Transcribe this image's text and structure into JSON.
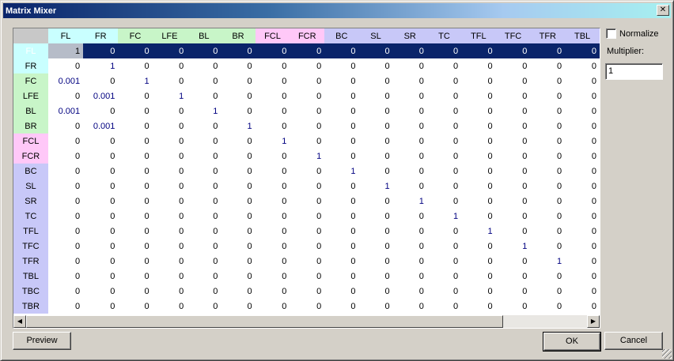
{
  "window": {
    "title": "Matrix Mixer",
    "close_glyph": "✕"
  },
  "columns": [
    {
      "label": "FL",
      "color": "#c9ffff"
    },
    {
      "label": "FR",
      "color": "#c9ffff"
    },
    {
      "label": "FC",
      "color": "#c8f5c8"
    },
    {
      "label": "LFE",
      "color": "#c8f5c8"
    },
    {
      "label": "BL",
      "color": "#c8f5c8"
    },
    {
      "label": "BR",
      "color": "#c8f5c8"
    },
    {
      "label": "FCL",
      "color": "#ffc8f8"
    },
    {
      "label": "FCR",
      "color": "#ffc8f8"
    },
    {
      "label": "BC",
      "color": "#c8c8f8"
    },
    {
      "label": "SL",
      "color": "#c8c8f8"
    },
    {
      "label": "SR",
      "color": "#c8c8f8"
    },
    {
      "label": "TC",
      "color": "#c8c8f8"
    },
    {
      "label": "TFL",
      "color": "#c8c8f8"
    },
    {
      "label": "TFC",
      "color": "#c8c8f8"
    },
    {
      "label": "TFR",
      "color": "#c8c8f8"
    },
    {
      "label": "TBL",
      "color": "#c8c8f8"
    }
  ],
  "rows": [
    {
      "label": "FL",
      "color": "#c9ffff",
      "values": [
        "1",
        "0",
        "0",
        "0",
        "0",
        "0",
        "0",
        "0",
        "0",
        "0",
        "0",
        "0",
        "0",
        "0",
        "0",
        "0"
      ]
    },
    {
      "label": "FR",
      "color": "#c9ffff",
      "values": [
        "0",
        "1",
        "0",
        "0",
        "0",
        "0",
        "0",
        "0",
        "0",
        "0",
        "0",
        "0",
        "0",
        "0",
        "0",
        "0"
      ]
    },
    {
      "label": "FC",
      "color": "#c8f5c8",
      "values": [
        "0.001",
        "0",
        "1",
        "0",
        "0",
        "0",
        "0",
        "0",
        "0",
        "0",
        "0",
        "0",
        "0",
        "0",
        "0",
        "0"
      ]
    },
    {
      "label": "LFE",
      "color": "#c8f5c8",
      "values": [
        "0",
        "0.001",
        "0",
        "1",
        "0",
        "0",
        "0",
        "0",
        "0",
        "0",
        "0",
        "0",
        "0",
        "0",
        "0",
        "0"
      ]
    },
    {
      "label": "BL",
      "color": "#c8f5c8",
      "values": [
        "0.001",
        "0",
        "0",
        "0",
        "1",
        "0",
        "0",
        "0",
        "0",
        "0",
        "0",
        "0",
        "0",
        "0",
        "0",
        "0"
      ]
    },
    {
      "label": "BR",
      "color": "#c8f5c8",
      "values": [
        "0",
        "0.001",
        "0",
        "0",
        "0",
        "1",
        "0",
        "0",
        "0",
        "0",
        "0",
        "0",
        "0",
        "0",
        "0",
        "0"
      ]
    },
    {
      "label": "FCL",
      "color": "#ffc8f8",
      "values": [
        "0",
        "0",
        "0",
        "0",
        "0",
        "0",
        "1",
        "0",
        "0",
        "0",
        "0",
        "0",
        "0",
        "0",
        "0",
        "0"
      ]
    },
    {
      "label": "FCR",
      "color": "#ffc8f8",
      "values": [
        "0",
        "0",
        "0",
        "0",
        "0",
        "0",
        "0",
        "1",
        "0",
        "0",
        "0",
        "0",
        "0",
        "0",
        "0",
        "0"
      ]
    },
    {
      "label": "BC",
      "color": "#c8c8f8",
      "values": [
        "0",
        "0",
        "0",
        "0",
        "0",
        "0",
        "0",
        "0",
        "1",
        "0",
        "0",
        "0",
        "0",
        "0",
        "0",
        "0"
      ]
    },
    {
      "label": "SL",
      "color": "#c8c8f8",
      "values": [
        "0",
        "0",
        "0",
        "0",
        "0",
        "0",
        "0",
        "0",
        "0",
        "1",
        "0",
        "0",
        "0",
        "0",
        "0",
        "0"
      ]
    },
    {
      "label": "SR",
      "color": "#c8c8f8",
      "values": [
        "0",
        "0",
        "0",
        "0",
        "0",
        "0",
        "0",
        "0",
        "0",
        "0",
        "1",
        "0",
        "0",
        "0",
        "0",
        "0"
      ]
    },
    {
      "label": "TC",
      "color": "#c8c8f8",
      "values": [
        "0",
        "0",
        "0",
        "0",
        "0",
        "0",
        "0",
        "0",
        "0",
        "0",
        "0",
        "1",
        "0",
        "0",
        "0",
        "0"
      ]
    },
    {
      "label": "TFL",
      "color": "#c8c8f8",
      "values": [
        "0",
        "0",
        "0",
        "0",
        "0",
        "0",
        "0",
        "0",
        "0",
        "0",
        "0",
        "0",
        "1",
        "0",
        "0",
        "0"
      ]
    },
    {
      "label": "TFC",
      "color": "#c8c8f8",
      "values": [
        "0",
        "0",
        "0",
        "0",
        "0",
        "0",
        "0",
        "0",
        "0",
        "0",
        "0",
        "0",
        "0",
        "1",
        "0",
        "0"
      ]
    },
    {
      "label": "TFR",
      "color": "#c8c8f8",
      "values": [
        "0",
        "0",
        "0",
        "0",
        "0",
        "0",
        "0",
        "0",
        "0",
        "0",
        "0",
        "0",
        "0",
        "0",
        "1",
        "0"
      ]
    },
    {
      "label": "TBL",
      "color": "#c8c8f8",
      "values": [
        "0",
        "0",
        "0",
        "0",
        "0",
        "0",
        "0",
        "0",
        "0",
        "0",
        "0",
        "0",
        "0",
        "0",
        "0",
        "0"
      ]
    },
    {
      "label": "TBC",
      "color": "#c8c8f8",
      "values": [
        "0",
        "0",
        "0",
        "0",
        "0",
        "0",
        "0",
        "0",
        "0",
        "0",
        "0",
        "0",
        "0",
        "0",
        "0",
        "0"
      ]
    },
    {
      "label": "TBR",
      "color": "#c8c8f8",
      "values": [
        "0",
        "0",
        "0",
        "0",
        "0",
        "0",
        "0",
        "0",
        "0",
        "0",
        "0",
        "0",
        "0",
        "0",
        "0",
        "0"
      ]
    }
  ],
  "selected_row": 0,
  "options": {
    "normalize_label": "Normalize",
    "normalize_checked": false,
    "multiplier_label": "Multiplier:",
    "multiplier_value": "1"
  },
  "buttons": {
    "preview": "Preview",
    "ok": "OK",
    "cancel": "Cancel"
  },
  "scrollbar": {
    "left_arrow": "◀",
    "right_arrow": "▶"
  }
}
